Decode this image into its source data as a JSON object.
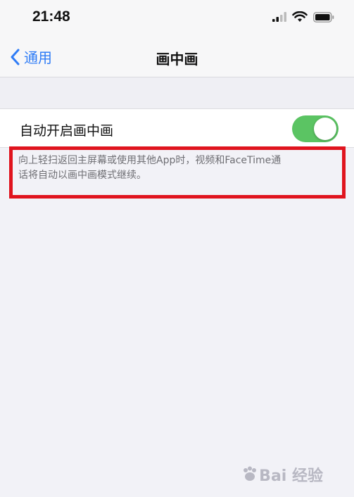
{
  "status_bar": {
    "time": "21:48",
    "icons": [
      "cellular-signal-icon",
      "wifi-icon",
      "battery-icon"
    ]
  },
  "nav": {
    "back_label": "通用",
    "title": "画中画"
  },
  "setting": {
    "label": "自动开启画中画",
    "toggle_on": true
  },
  "footer": {
    "description_line1": "向上轻扫返回主屏幕或使用其他App时，视频和FaceTime通",
    "description_line2": "话将自动以画中画模式继续。"
  },
  "watermark": {
    "text": "Bai 经验"
  },
  "colors": {
    "accent": "#2f7cf6",
    "toggle_on": "#5bc463",
    "highlight": "#e0141e",
    "background": "#f2f2f7"
  }
}
